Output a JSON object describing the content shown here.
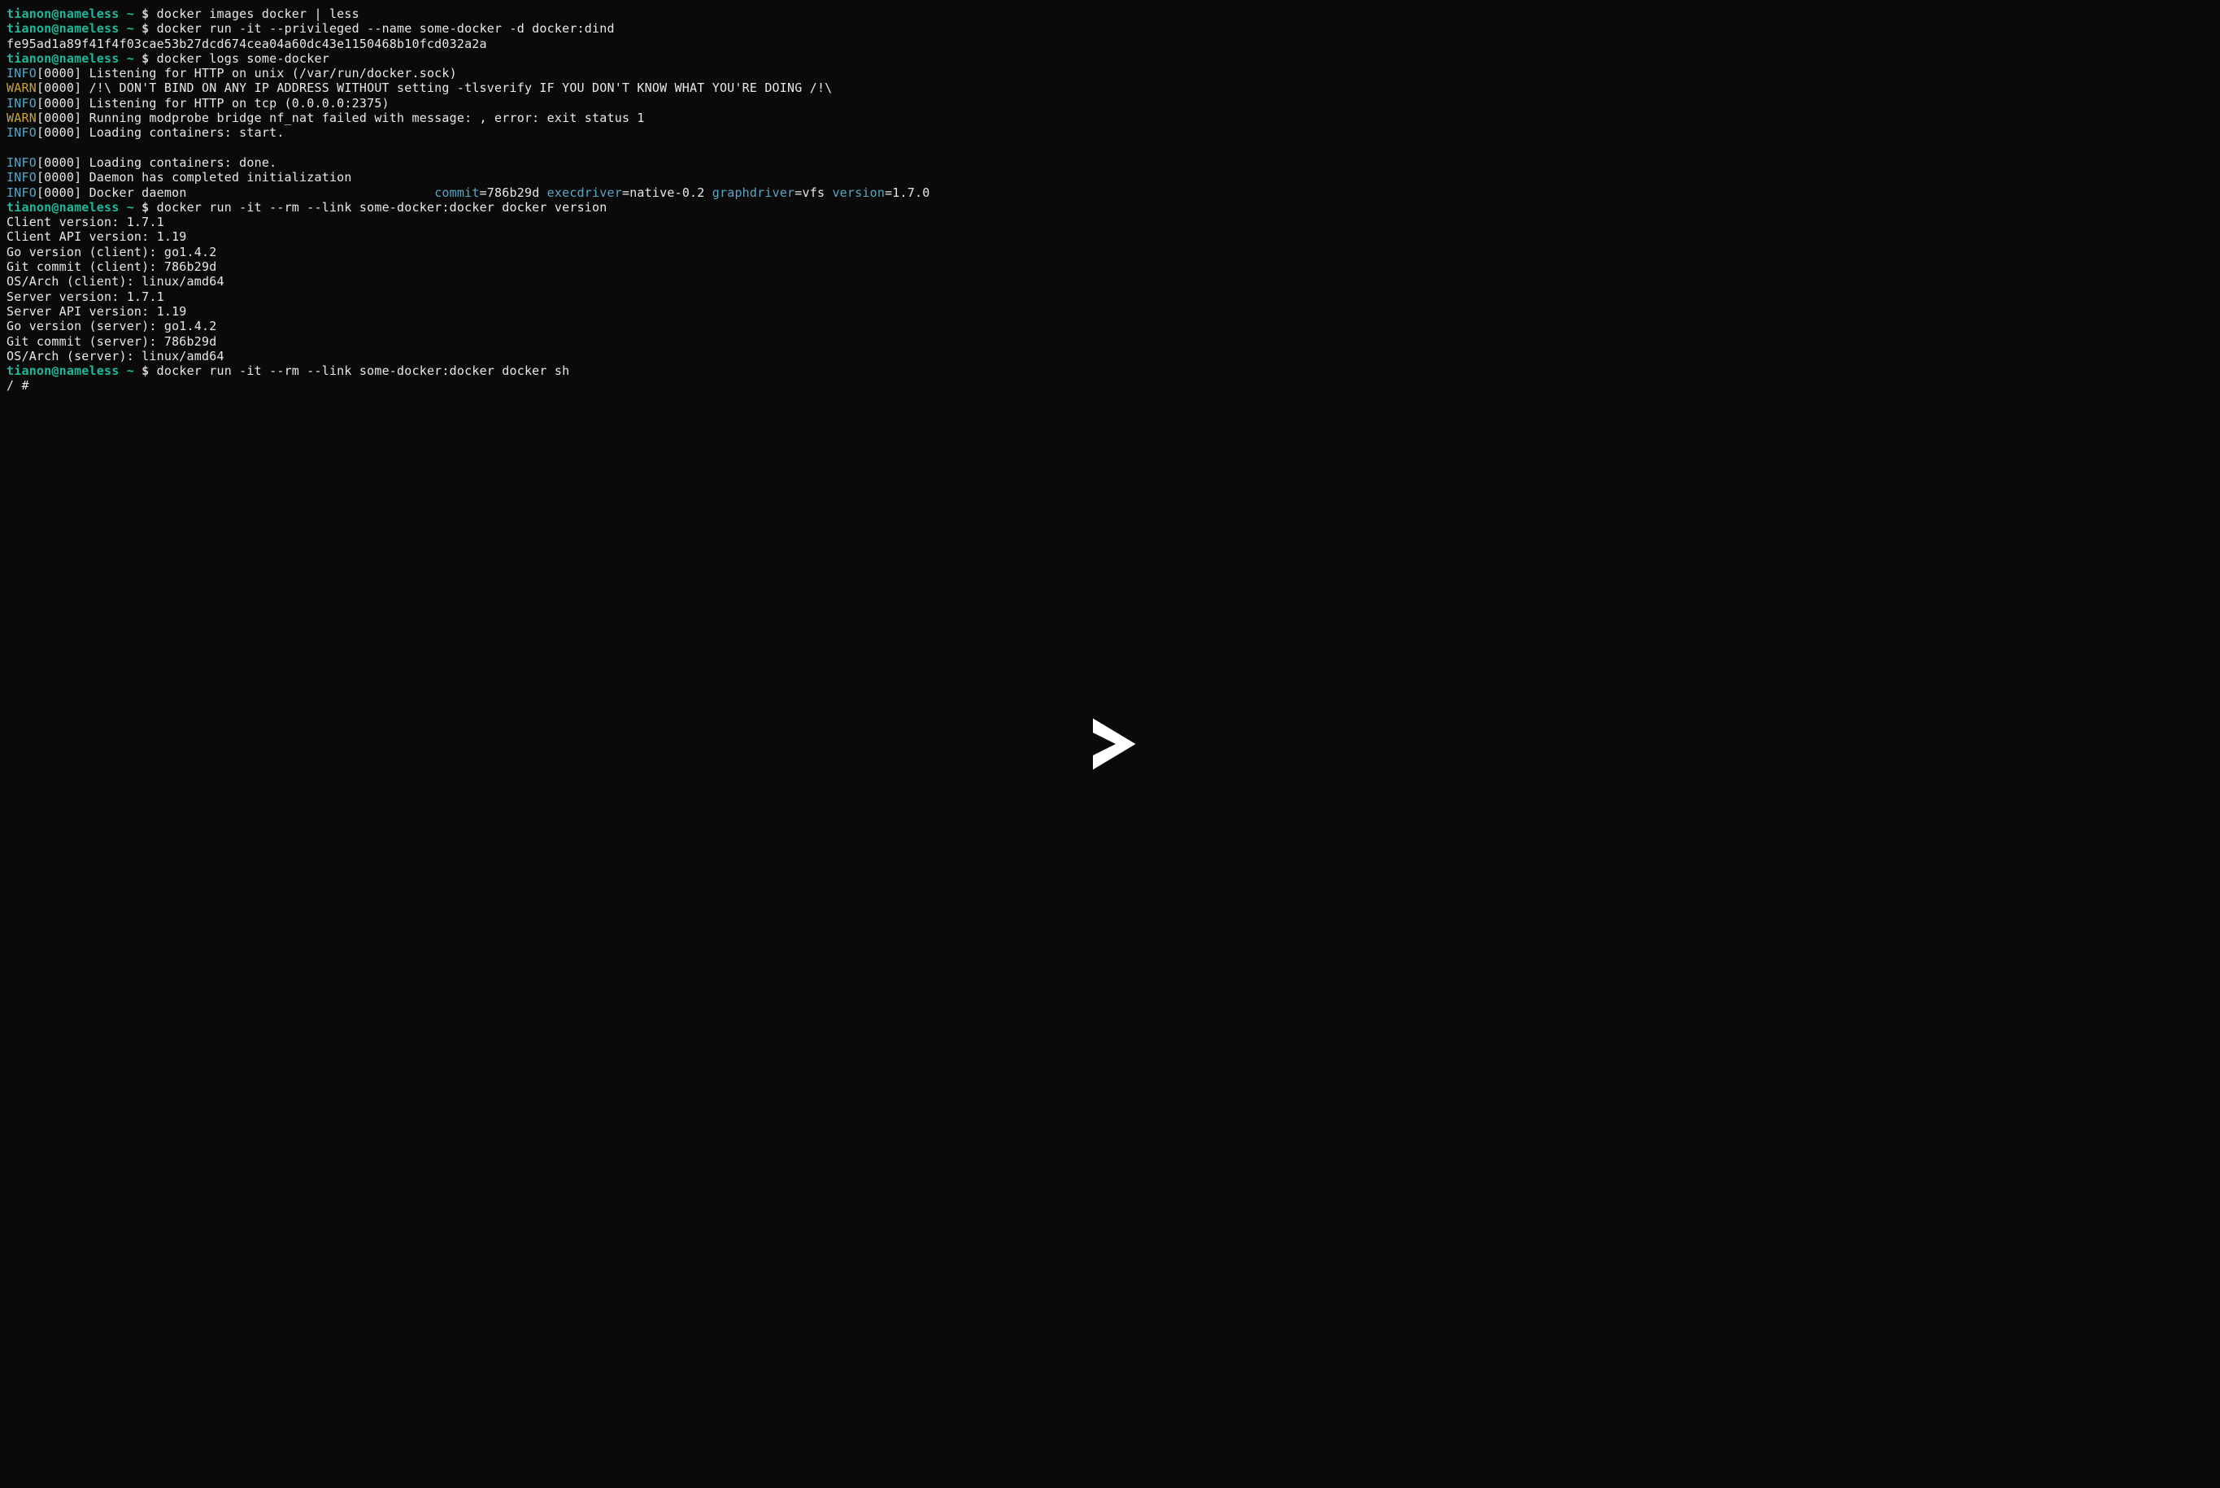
{
  "prompt": {
    "user": "tianon@nameless",
    "tilde": "~",
    "dollar": "$"
  },
  "commands": {
    "c1": "docker images docker | less",
    "c2": "docker run -it --privileged --name some-docker -d docker:dind",
    "c3": "docker logs some-docker",
    "c4": "docker run -it --rm --link some-docker:docker docker version",
    "c5": "docker run -it --rm --link some-docker:docker docker sh"
  },
  "outputs": {
    "container_id": "fe95ad1a89f41f4f03cae53b27dcd674cea04a60dc43e1150468b10fcd032a2a",
    "log1": {
      "level": "INFO",
      "ts": "[0000]",
      "msg": "Listening for HTTP on unix (/var/run/docker.sock)"
    },
    "log2": {
      "level": "WARN",
      "ts": "[0000]",
      "msg": "/!\\ DON'T BIND ON ANY IP ADDRESS WITHOUT setting -tlsverify IF YOU DON'T KNOW WHAT YOU'RE DOING /!\\"
    },
    "log3": {
      "level": "INFO",
      "ts": "[0000]",
      "msg": "Listening for HTTP on tcp (0.0.0.0:2375)"
    },
    "log4": {
      "level": "WARN",
      "ts": "[0000]",
      "msg": "Running modprobe bridge nf_nat failed with message: , error: exit status 1"
    },
    "log5": {
      "level": "INFO",
      "ts": "[0000]",
      "msg": "Loading containers: start."
    },
    "log6": {
      "level": "INFO",
      "ts": "[0000]",
      "msg": "Loading containers: done."
    },
    "log7": {
      "level": "INFO",
      "ts": "[0000]",
      "msg": "Daemon has completed initialization"
    },
    "log8": {
      "level": "INFO",
      "ts": "[0000]",
      "msg": "Docker daemon",
      "pad": "                                 ",
      "kv": [
        {
          "key": "commit",
          "val": "=786b29d "
        },
        {
          "key": "execdriver",
          "val": "=native-0.2 "
        },
        {
          "key": "graphdriver",
          "val": "=vfs "
        },
        {
          "key": "version",
          "val": "=1.7.0"
        }
      ]
    },
    "version": {
      "l1": "Client version: 1.7.1",
      "l2": "Client API version: 1.19",
      "l3": "Go version (client): go1.4.2",
      "l4": "Git commit (client): 786b29d",
      "l5": "OS/Arch (client): linux/amd64",
      "l6": "Server version: 1.7.1",
      "l7": "Server API version: 1.19",
      "l8": "Go version (server): go1.4.2",
      "l9": "Git commit (server): 786b29d",
      "l10": "OS/Arch (server): linux/amd64"
    },
    "shell_prompt": "/ #"
  }
}
